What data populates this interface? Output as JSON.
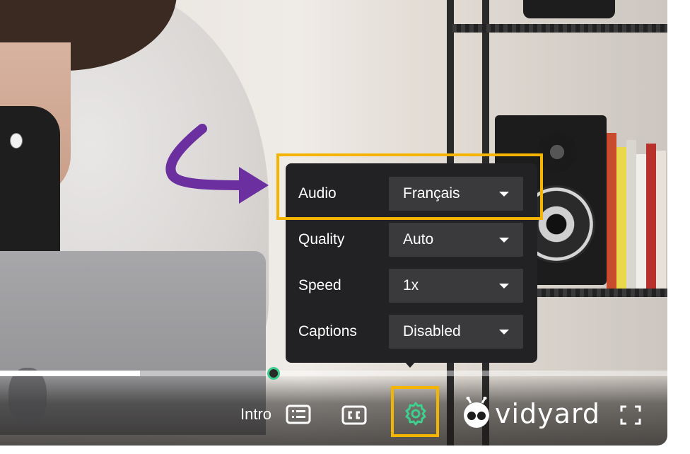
{
  "settings": {
    "rows": [
      {
        "label": "Audio",
        "value": "Français"
      },
      {
        "label": "Quality",
        "value": "Auto"
      },
      {
        "label": "Speed",
        "value": "1x"
      },
      {
        "label": "Captions",
        "value": "Disabled"
      }
    ]
  },
  "controls": {
    "chapter_label": "Intro",
    "chapters_icon": "chapters-list-icon",
    "captions_icon": "closed-captions-icon",
    "settings_icon": "gear-icon",
    "fullscreen_icon": "fullscreen-icon",
    "brand": "vidyard"
  },
  "progress": {
    "played_fraction": 0.41,
    "buffered_fraction": 0.21
  },
  "colors": {
    "highlight": "#f5b400",
    "arrow": "#6b2fa0",
    "accent_green": "#3ecf8e",
    "panel": "#222224",
    "select": "#3a3a3c"
  }
}
